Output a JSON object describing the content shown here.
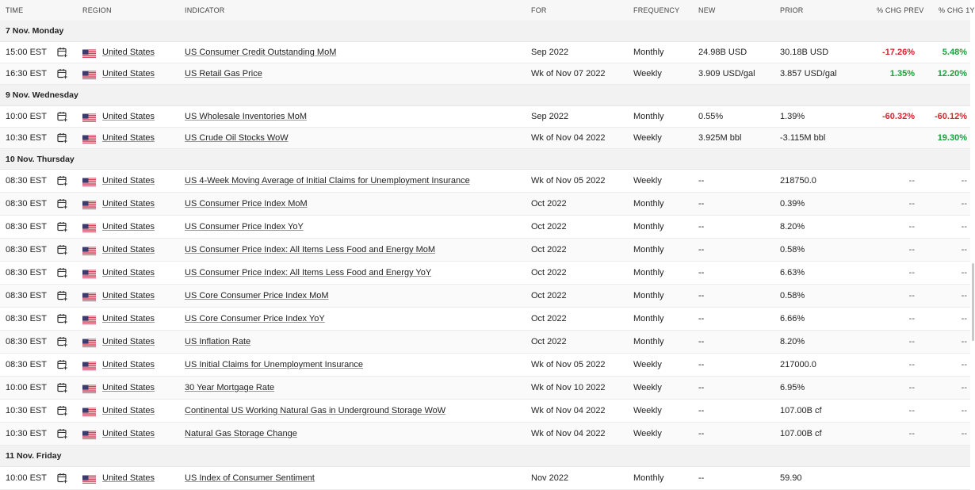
{
  "headers": {
    "time": "TIME",
    "region": "REGION",
    "indicator": "INDICATOR",
    "for": "FOR",
    "frequency": "FREQUENCY",
    "new": "NEW",
    "prior": "PRIOR",
    "chg_prev": "% CHG PREV",
    "chg_1y": "% CHG 1Y"
  },
  "colors": {
    "negative": "#e0202f",
    "positive": "#1aa03a",
    "flag_red": "#c8102e",
    "flag_blue": "#3c3b6e"
  },
  "icons": {
    "calendar": "calendar-add-icon",
    "flag": "us-flag-icon"
  },
  "groups": [
    {
      "label": "7 Nov. Monday",
      "rows": [
        {
          "time": "15:00 EST",
          "region": "United States",
          "indicator": "US Consumer Credit Outstanding MoM",
          "for": "Sep 2022",
          "frequency": "Monthly",
          "new": "24.98B USD",
          "prior": "30.18B USD",
          "chg_prev": "-17.26%",
          "chg_prev_sign": "neg",
          "chg_1y": "5.48%",
          "chg_1y_sign": "pos"
        },
        {
          "time": "16:30 EST",
          "region": "United States",
          "indicator": "US Retail Gas Price",
          "for": "Wk of Nov 07 2022",
          "frequency": "Weekly",
          "new": "3.909 USD/gal",
          "prior": "3.857 USD/gal",
          "chg_prev": "1.35%",
          "chg_prev_sign": "pos",
          "chg_1y": "12.20%",
          "chg_1y_sign": "pos"
        }
      ]
    },
    {
      "label": "9 Nov. Wednesday",
      "rows": [
        {
          "time": "10:00 EST",
          "region": "United States",
          "indicator": "US Wholesale Inventories MoM",
          "for": "Sep 2022",
          "frequency": "Monthly",
          "new": "0.55%",
          "prior": "1.39%",
          "chg_prev": "-60.32%",
          "chg_prev_sign": "neg",
          "chg_1y": "-60.12%",
          "chg_1y_sign": "neg"
        },
        {
          "time": "10:30 EST",
          "region": "United States",
          "indicator": "US Crude Oil Stocks WoW",
          "for": "Wk of Nov 04 2022",
          "frequency": "Weekly",
          "new": "3.925M bbl",
          "prior": "-3.115M bbl",
          "chg_prev": "",
          "chg_prev_sign": "",
          "chg_1y": "19.30%",
          "chg_1y_sign": "pos"
        }
      ]
    },
    {
      "label": "10 Nov. Thursday",
      "rows": [
        {
          "time": "08:30 EST",
          "region": "United States",
          "indicator": "US 4-Week Moving Average of Initial Claims for Unemployment Insurance",
          "for": "Wk of Nov 05 2022",
          "frequency": "Weekly",
          "new": "--",
          "prior": "218750.0",
          "chg_prev": "--",
          "chg_prev_sign": "dash",
          "chg_1y": "--",
          "chg_1y_sign": "dash"
        },
        {
          "time": "08:30 EST",
          "region": "United States",
          "indicator": "US Consumer Price Index MoM",
          "for": "Oct 2022",
          "frequency": "Monthly",
          "new": "--",
          "prior": "0.39%",
          "chg_prev": "--",
          "chg_prev_sign": "dash",
          "chg_1y": "--",
          "chg_1y_sign": "dash"
        },
        {
          "time": "08:30 EST",
          "region": "United States",
          "indicator": "US Consumer Price Index YoY",
          "for": "Oct 2022",
          "frequency": "Monthly",
          "new": "--",
          "prior": "8.20%",
          "chg_prev": "--",
          "chg_prev_sign": "dash",
          "chg_1y": "--",
          "chg_1y_sign": "dash"
        },
        {
          "time": "08:30 EST",
          "region": "United States",
          "indicator": "US Consumer Price Index: All Items Less Food and Energy MoM",
          "for": "Oct 2022",
          "frequency": "Monthly",
          "new": "--",
          "prior": "0.58%",
          "chg_prev": "--",
          "chg_prev_sign": "dash",
          "chg_1y": "--",
          "chg_1y_sign": "dash"
        },
        {
          "time": "08:30 EST",
          "region": "United States",
          "indicator": "US Consumer Price Index: All Items Less Food and Energy YoY",
          "for": "Oct 2022",
          "frequency": "Monthly",
          "new": "--",
          "prior": "6.63%",
          "chg_prev": "--",
          "chg_prev_sign": "dash",
          "chg_1y": "--",
          "chg_1y_sign": "dash"
        },
        {
          "time": "08:30 EST",
          "region": "United States",
          "indicator": "US Core Consumer Price Index MoM",
          "for": "Oct 2022",
          "frequency": "Monthly",
          "new": "--",
          "prior": "0.58%",
          "chg_prev": "--",
          "chg_prev_sign": "dash",
          "chg_1y": "--",
          "chg_1y_sign": "dash"
        },
        {
          "time": "08:30 EST",
          "region": "United States",
          "indicator": "US Core Consumer Price Index YoY",
          "for": "Oct 2022",
          "frequency": "Monthly",
          "new": "--",
          "prior": "6.66%",
          "chg_prev": "--",
          "chg_prev_sign": "dash",
          "chg_1y": "--",
          "chg_1y_sign": "dash"
        },
        {
          "time": "08:30 EST",
          "region": "United States",
          "indicator": "US Inflation Rate",
          "for": "Oct 2022",
          "frequency": "Monthly",
          "new": "--",
          "prior": "8.20%",
          "chg_prev": "--",
          "chg_prev_sign": "dash",
          "chg_1y": "--",
          "chg_1y_sign": "dash"
        },
        {
          "time": "08:30 EST",
          "region": "United States",
          "indicator": "US Initial Claims for Unemployment Insurance",
          "for": "Wk of Nov 05 2022",
          "frequency": "Weekly",
          "new": "--",
          "prior": "217000.0",
          "chg_prev": "--",
          "chg_prev_sign": "dash",
          "chg_1y": "--",
          "chg_1y_sign": "dash"
        },
        {
          "time": "10:00 EST",
          "region": "United States",
          "indicator": "30 Year Mortgage Rate",
          "for": "Wk of Nov 10 2022",
          "frequency": "Weekly",
          "new": "--",
          "prior": "6.95%",
          "chg_prev": "--",
          "chg_prev_sign": "dash",
          "chg_1y": "--",
          "chg_1y_sign": "dash"
        },
        {
          "time": "10:30 EST",
          "region": "United States",
          "indicator": "Continental US Working Natural Gas in Underground Storage WoW",
          "for": "Wk of Nov 04 2022",
          "frequency": "Weekly",
          "new": "--",
          "prior": "107.00B cf",
          "chg_prev": "--",
          "chg_prev_sign": "dash",
          "chg_1y": "--",
          "chg_1y_sign": "dash"
        },
        {
          "time": "10:30 EST",
          "region": "United States",
          "indicator": "Natural Gas Storage Change",
          "for": "Wk of Nov 04 2022",
          "frequency": "Weekly",
          "new": "--",
          "prior": "107.00B cf",
          "chg_prev": "--",
          "chg_prev_sign": "dash",
          "chg_1y": "--",
          "chg_1y_sign": "dash"
        }
      ]
    },
    {
      "label": "11 Nov. Friday",
      "rows": [
        {
          "time": "10:00 EST",
          "region": "United States",
          "indicator": "US Index of Consumer Sentiment",
          "for": "Nov 2022",
          "frequency": "Monthly",
          "new": "--",
          "prior": "59.90",
          "chg_prev": "",
          "chg_prev_sign": "",
          "chg_1y": "",
          "chg_1y_sign": ""
        }
      ]
    }
  ]
}
